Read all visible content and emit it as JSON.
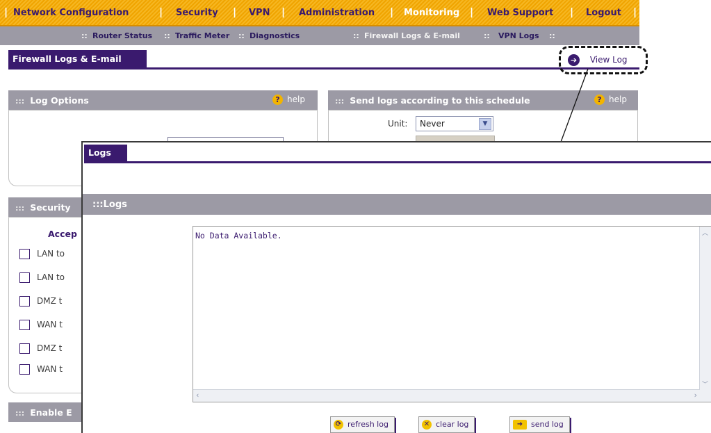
{
  "nav": {
    "items": [
      "Network Configuration",
      "Security",
      "VPN",
      "Administration",
      "Monitoring",
      "Web Support",
      "Logout"
    ],
    "active": "Monitoring"
  },
  "subnav": {
    "items": [
      "Router Status",
      "Traffic Meter",
      "Diagnostics",
      "Firewall Logs & E-mail",
      "VPN Logs"
    ],
    "active": "Firewall Logs & E-mail"
  },
  "page": {
    "tab": "Firewall Logs & E-mail",
    "view_log": "View Log"
  },
  "log_options": {
    "title": "Log Options",
    "help": "help"
  },
  "schedule": {
    "title": "Send logs according to this schedule",
    "help": "help",
    "unit_label": "Unit:",
    "unit_value": "Never"
  },
  "security": {
    "title": "Security",
    "accept_label": "Accep",
    "rows": [
      "LAN to",
      "LAN to",
      "DMZ t",
      "WAN t",
      "DMZ t",
      "WAN t"
    ]
  },
  "enable": {
    "title": "Enable E"
  },
  "logs_window": {
    "tab": "Logs",
    "section_title": "Logs",
    "content": "No Data Available.",
    "buttons": {
      "refresh": "refresh log",
      "clear": "clear log",
      "send": "send log"
    }
  },
  "colors": {
    "brand_purple": "#3a1a6e",
    "nav_orange": "#f0a400",
    "panel_gray": "#9c9aa5"
  }
}
